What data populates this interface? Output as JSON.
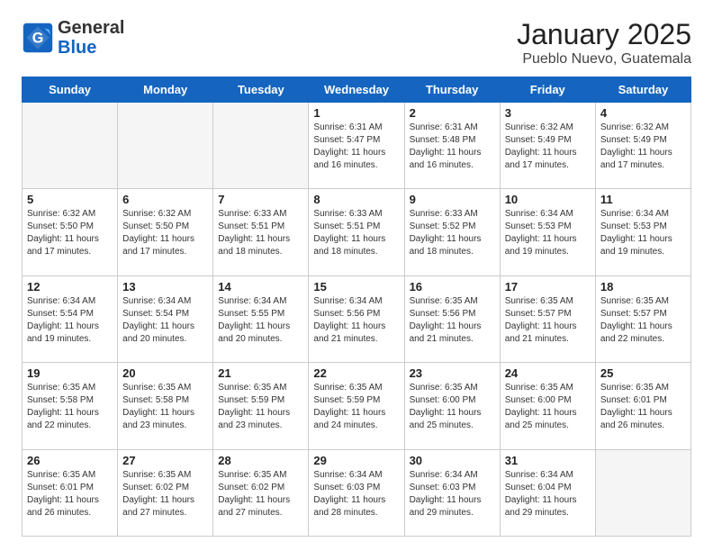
{
  "header": {
    "logo": {
      "general": "General",
      "blue": "Blue"
    },
    "month_year": "January 2025",
    "location": "Pueblo Nuevo, Guatemala"
  },
  "weekdays": [
    "Sunday",
    "Monday",
    "Tuesday",
    "Wednesday",
    "Thursday",
    "Friday",
    "Saturday"
  ],
  "weeks": [
    [
      {
        "day": "",
        "info": ""
      },
      {
        "day": "",
        "info": ""
      },
      {
        "day": "",
        "info": ""
      },
      {
        "day": "1",
        "info": "Sunrise: 6:31 AM\nSunset: 5:47 PM\nDaylight: 11 hours\nand 16 minutes."
      },
      {
        "day": "2",
        "info": "Sunrise: 6:31 AM\nSunset: 5:48 PM\nDaylight: 11 hours\nand 16 minutes."
      },
      {
        "day": "3",
        "info": "Sunrise: 6:32 AM\nSunset: 5:49 PM\nDaylight: 11 hours\nand 17 minutes."
      },
      {
        "day": "4",
        "info": "Sunrise: 6:32 AM\nSunset: 5:49 PM\nDaylight: 11 hours\nand 17 minutes."
      }
    ],
    [
      {
        "day": "5",
        "info": "Sunrise: 6:32 AM\nSunset: 5:50 PM\nDaylight: 11 hours\nand 17 minutes."
      },
      {
        "day": "6",
        "info": "Sunrise: 6:32 AM\nSunset: 5:50 PM\nDaylight: 11 hours\nand 17 minutes."
      },
      {
        "day": "7",
        "info": "Sunrise: 6:33 AM\nSunset: 5:51 PM\nDaylight: 11 hours\nand 18 minutes."
      },
      {
        "day": "8",
        "info": "Sunrise: 6:33 AM\nSunset: 5:51 PM\nDaylight: 11 hours\nand 18 minutes."
      },
      {
        "day": "9",
        "info": "Sunrise: 6:33 AM\nSunset: 5:52 PM\nDaylight: 11 hours\nand 18 minutes."
      },
      {
        "day": "10",
        "info": "Sunrise: 6:34 AM\nSunset: 5:53 PM\nDaylight: 11 hours\nand 19 minutes."
      },
      {
        "day": "11",
        "info": "Sunrise: 6:34 AM\nSunset: 5:53 PM\nDaylight: 11 hours\nand 19 minutes."
      }
    ],
    [
      {
        "day": "12",
        "info": "Sunrise: 6:34 AM\nSunset: 5:54 PM\nDaylight: 11 hours\nand 19 minutes."
      },
      {
        "day": "13",
        "info": "Sunrise: 6:34 AM\nSunset: 5:54 PM\nDaylight: 11 hours\nand 20 minutes."
      },
      {
        "day": "14",
        "info": "Sunrise: 6:34 AM\nSunset: 5:55 PM\nDaylight: 11 hours\nand 20 minutes."
      },
      {
        "day": "15",
        "info": "Sunrise: 6:34 AM\nSunset: 5:56 PM\nDaylight: 11 hours\nand 21 minutes."
      },
      {
        "day": "16",
        "info": "Sunrise: 6:35 AM\nSunset: 5:56 PM\nDaylight: 11 hours\nand 21 minutes."
      },
      {
        "day": "17",
        "info": "Sunrise: 6:35 AM\nSunset: 5:57 PM\nDaylight: 11 hours\nand 21 minutes."
      },
      {
        "day": "18",
        "info": "Sunrise: 6:35 AM\nSunset: 5:57 PM\nDaylight: 11 hours\nand 22 minutes."
      }
    ],
    [
      {
        "day": "19",
        "info": "Sunrise: 6:35 AM\nSunset: 5:58 PM\nDaylight: 11 hours\nand 22 minutes."
      },
      {
        "day": "20",
        "info": "Sunrise: 6:35 AM\nSunset: 5:58 PM\nDaylight: 11 hours\nand 23 minutes."
      },
      {
        "day": "21",
        "info": "Sunrise: 6:35 AM\nSunset: 5:59 PM\nDaylight: 11 hours\nand 23 minutes."
      },
      {
        "day": "22",
        "info": "Sunrise: 6:35 AM\nSunset: 5:59 PM\nDaylight: 11 hours\nand 24 minutes."
      },
      {
        "day": "23",
        "info": "Sunrise: 6:35 AM\nSunset: 6:00 PM\nDaylight: 11 hours\nand 25 minutes."
      },
      {
        "day": "24",
        "info": "Sunrise: 6:35 AM\nSunset: 6:00 PM\nDaylight: 11 hours\nand 25 minutes."
      },
      {
        "day": "25",
        "info": "Sunrise: 6:35 AM\nSunset: 6:01 PM\nDaylight: 11 hours\nand 26 minutes."
      }
    ],
    [
      {
        "day": "26",
        "info": "Sunrise: 6:35 AM\nSunset: 6:01 PM\nDaylight: 11 hours\nand 26 minutes."
      },
      {
        "day": "27",
        "info": "Sunrise: 6:35 AM\nSunset: 6:02 PM\nDaylight: 11 hours\nand 27 minutes."
      },
      {
        "day": "28",
        "info": "Sunrise: 6:35 AM\nSunset: 6:02 PM\nDaylight: 11 hours\nand 27 minutes."
      },
      {
        "day": "29",
        "info": "Sunrise: 6:34 AM\nSunset: 6:03 PM\nDaylight: 11 hours\nand 28 minutes."
      },
      {
        "day": "30",
        "info": "Sunrise: 6:34 AM\nSunset: 6:03 PM\nDaylight: 11 hours\nand 29 minutes."
      },
      {
        "day": "31",
        "info": "Sunrise: 6:34 AM\nSunset: 6:04 PM\nDaylight: 11 hours\nand 29 minutes."
      },
      {
        "day": "",
        "info": ""
      }
    ]
  ]
}
